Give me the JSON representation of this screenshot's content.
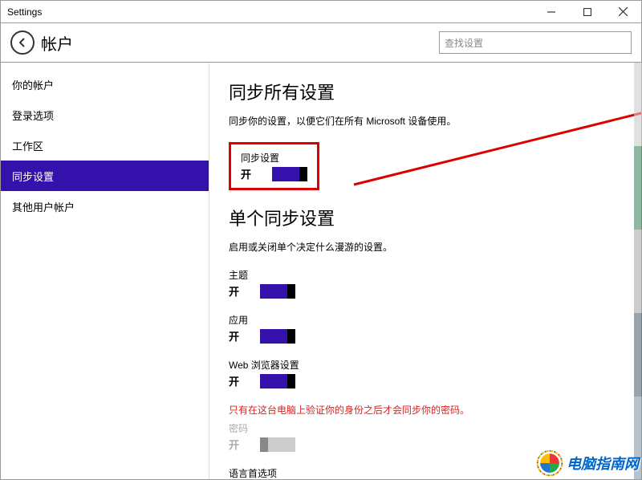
{
  "window": {
    "title": "Settings"
  },
  "header": {
    "category": "帐户",
    "search_placeholder": "查找设置"
  },
  "sidebar": {
    "items": [
      {
        "label": "你的帐户"
      },
      {
        "label": "登录选项"
      },
      {
        "label": "工作区"
      },
      {
        "label": "同步设置"
      },
      {
        "label": "其他用户帐户"
      }
    ],
    "active_index": 3
  },
  "content": {
    "section1_title": "同步所有设置",
    "section1_desc": "同步你的设置，以便它们在所有 Microsoft 设备使用。",
    "sync_master": {
      "label": "同步设置",
      "state": "开",
      "on": true
    },
    "section2_title": "单个同步设置",
    "section2_desc": "启用或关闭单个决定什么漫游的设置。",
    "items": [
      {
        "label": "主题",
        "state": "开",
        "on": true
      },
      {
        "label": "应用",
        "state": "开",
        "on": true
      },
      {
        "label": "Web 浏览器设置",
        "state": "开",
        "on": true
      }
    ],
    "warning": "只有在这台电脑上验证你的身份之后才会同步你的密码。",
    "password": {
      "label": "密码",
      "state": "开",
      "on": false
    },
    "lang": {
      "label": "语言首选项"
    }
  },
  "watermark": {
    "text": "电脑指南网"
  }
}
